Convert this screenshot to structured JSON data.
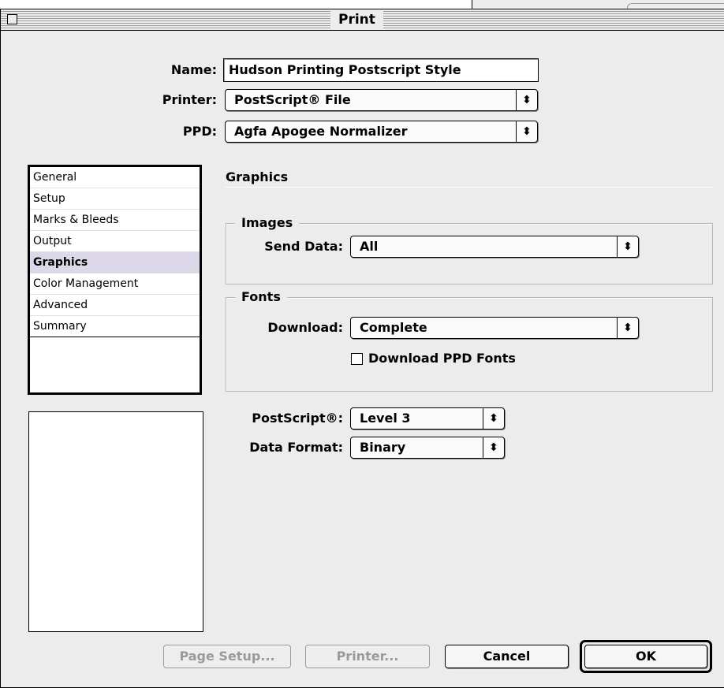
{
  "window": {
    "title": "Print"
  },
  "form": {
    "name_label": "Name:",
    "name_value": "Hudson Printing Postscript Style",
    "printer_label": "Printer:",
    "printer_value": "PostScript® File",
    "ppd_label": "PPD:",
    "ppd_value": "Agfa Apogee Normalizer"
  },
  "sidebar": {
    "items": [
      {
        "label": "General"
      },
      {
        "label": "Setup"
      },
      {
        "label": "Marks & Bleeds"
      },
      {
        "label": "Output"
      },
      {
        "label": "Graphics"
      },
      {
        "label": "Color Management"
      },
      {
        "label": "Advanced"
      },
      {
        "label": "Summary"
      }
    ],
    "selected_index": 4
  },
  "panel": {
    "heading": "Graphics",
    "images": {
      "title": "Images",
      "send_data_label": "Send Data:",
      "send_data_value": "All"
    },
    "fonts": {
      "title": "Fonts",
      "download_label": "Download:",
      "download_value": "Complete",
      "download_ppd_label": "Download PPD Fonts",
      "download_ppd_checked": false
    },
    "postscript_label": "PostScript®:",
    "postscript_value": "Level 3",
    "data_format_label": "Data Format:",
    "data_format_value": "Binary"
  },
  "buttons": {
    "page_setup": "Page Setup...",
    "printer": "Printer...",
    "cancel": "Cancel",
    "ok": "OK"
  },
  "icons": {
    "popup_arrows": "updown-arrows-icon",
    "close_box": "close-box-icon"
  }
}
